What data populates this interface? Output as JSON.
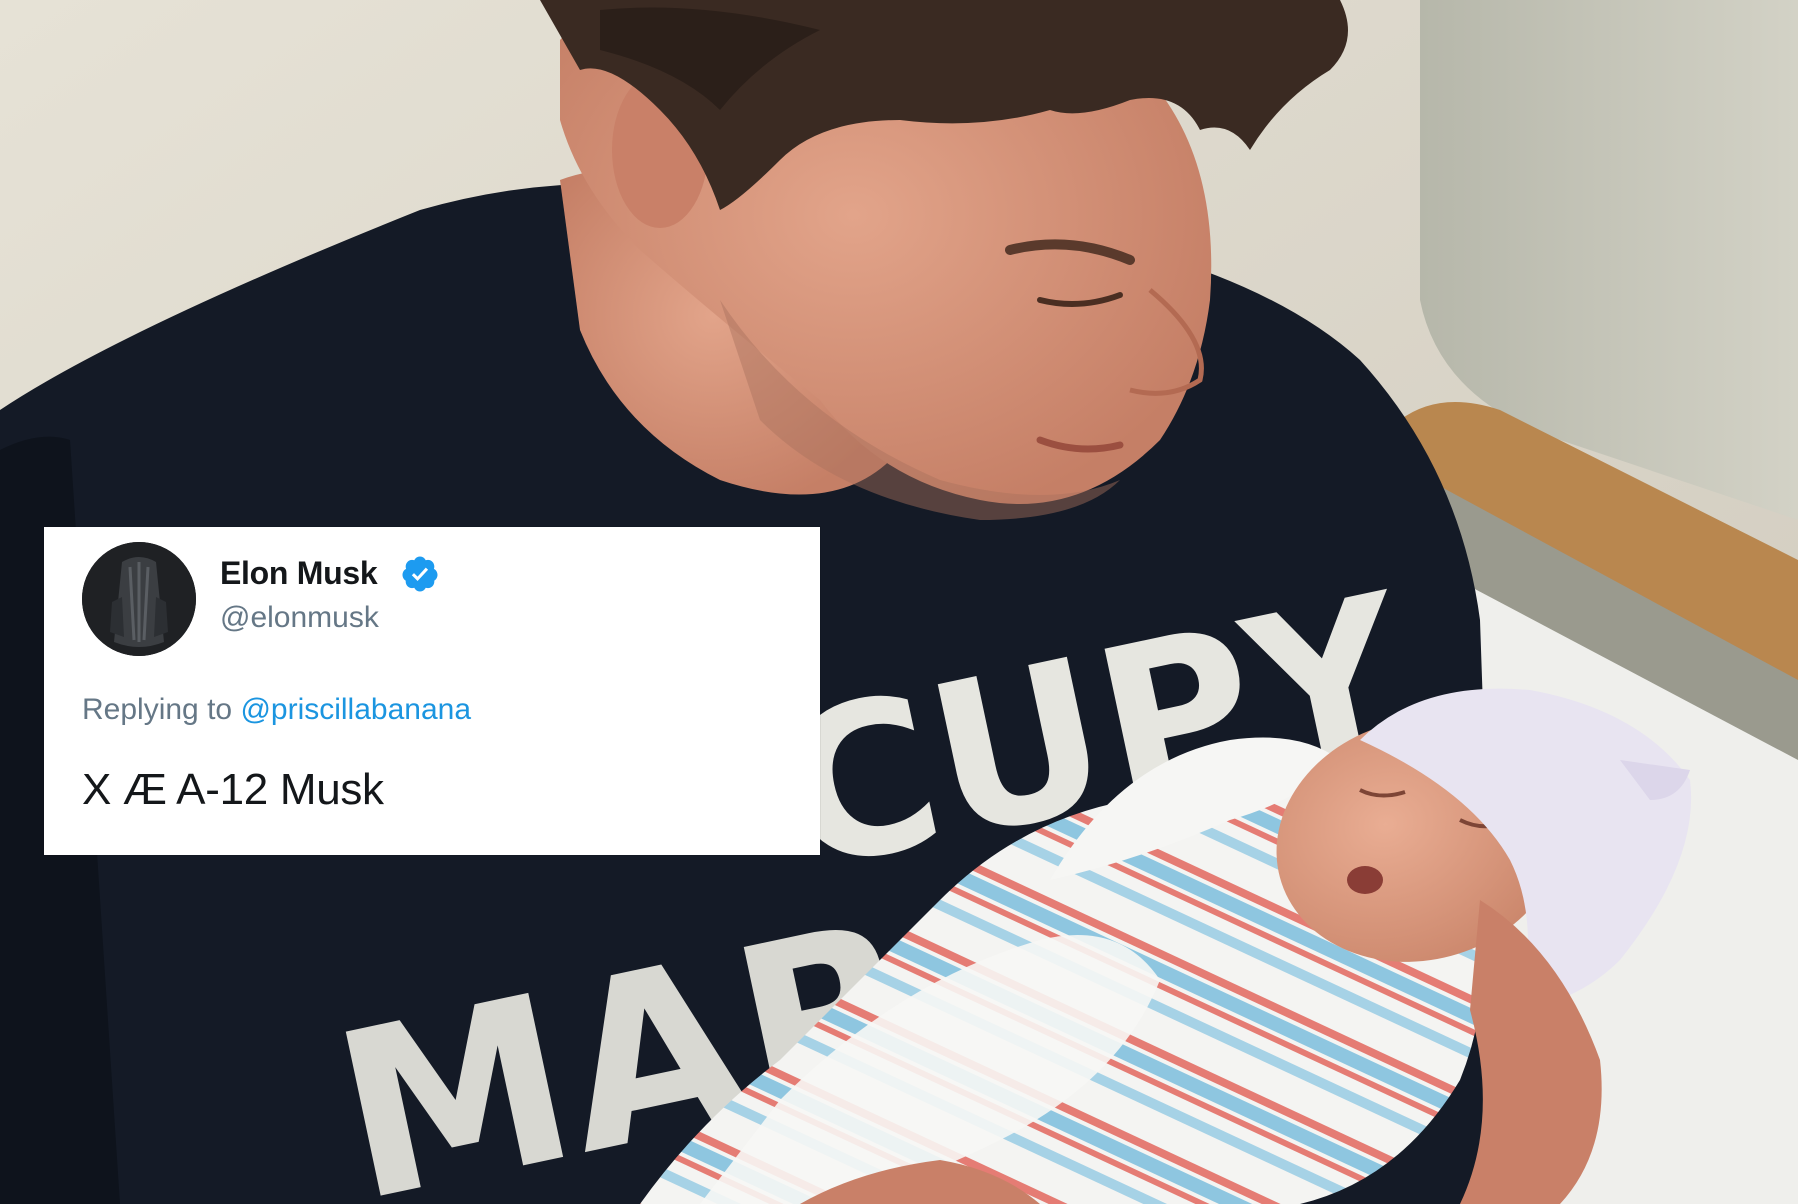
{
  "tweet": {
    "author_name": "Elon Musk",
    "handle": "@elonmusk",
    "replying_prefix": "Replying to",
    "replying_to": "@priscillabanana",
    "text": "X Æ A-12 Musk",
    "verified": true
  },
  "shirt": {
    "line1": "CUPY",
    "line2": "MAR"
  },
  "icons": {
    "verified": "verified-badge-icon",
    "avatar": "avatar-icon"
  },
  "colors": {
    "tweet_link": "#1b95e0",
    "handle_gray": "#657786",
    "text_dark": "#14171a",
    "verified_blue": "#1d9bf0",
    "shirt": "#141a26"
  }
}
